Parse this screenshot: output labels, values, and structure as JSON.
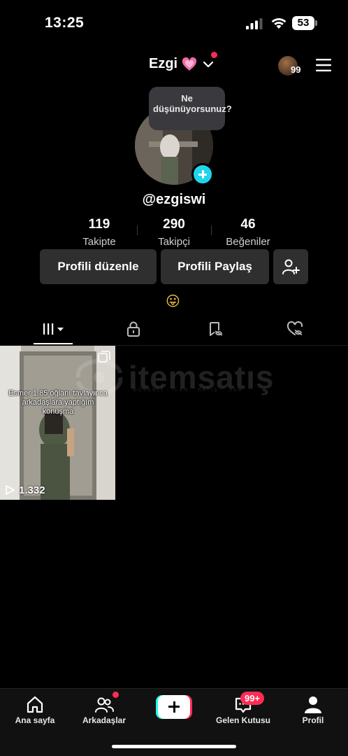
{
  "status_bar": {
    "time": "13:25",
    "battery": "53"
  },
  "header": {
    "account_name": "Ezgi",
    "story_count": "99"
  },
  "avatar": {
    "prompt": "Ne düşünüyorsunuz?"
  },
  "profile": {
    "username": "@ezgiswi",
    "bio_emoji": "😛"
  },
  "stats": [
    {
      "value": "119",
      "label": "Takipte"
    },
    {
      "value": "290",
      "label": "Takipçi"
    },
    {
      "value": "46",
      "label": "Beğeniler"
    }
  ],
  "actions": {
    "edit_profile": "Profili düzenle",
    "share_profile": "Profili Paylaş"
  },
  "videos": [
    {
      "caption": "Esmer 1.85 oğlanı tavlayınca arkadaşlara yaptığım konuşma",
      "views": "1.332"
    }
  ],
  "watermark": {
    "text": "itemsatış",
    "sub": "GÜVENLİ · İLAN · SATIŞ · .com"
  },
  "bottom_nav": {
    "home": "Ana sayfa",
    "friends": "Arkadaşlar",
    "inbox": "Gelen Kutusu",
    "inbox_badge": "99+",
    "profile": "Profil"
  },
  "colors": {
    "accent_cyan": "#20d5ec",
    "accent_red": "#fe2c55",
    "button_bg": "#2f2f2f"
  }
}
